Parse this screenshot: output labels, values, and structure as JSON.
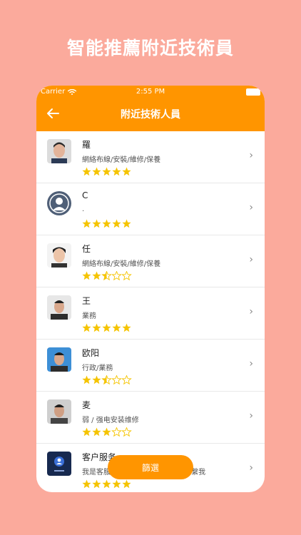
{
  "promo": {
    "title": "智能推薦附近技術員"
  },
  "status_bar": {
    "carrier": "Carrier",
    "time": "2:55 PM"
  },
  "nav": {
    "title": "附近技術人員"
  },
  "technicians": [
    {
      "name": "羅",
      "service": "網絡布線/安裝/維修/保養",
      "rating": 5
    },
    {
      "name": "C",
      "service": ".",
      "rating": 5
    },
    {
      "name": "任",
      "service": "網絡布線/安裝/維修/保養",
      "rating": 2.5
    },
    {
      "name": "王",
      "service": "業務",
      "rating": 5
    },
    {
      "name": "欧阳",
      "service": "行政/業務",
      "rating": 2.5
    },
    {
      "name": "麦",
      "service": "弱 / 强电安装维修",
      "rating": 3
    },
    {
      "name": "客户服务",
      "service": "我是客服 有任何問題可以告訴請聯繫我",
      "rating": 5
    }
  ],
  "filter": {
    "label": "篩選"
  },
  "colors": {
    "accent": "#ff9500",
    "star": "#f5c400",
    "background": "#fbaa9c"
  }
}
